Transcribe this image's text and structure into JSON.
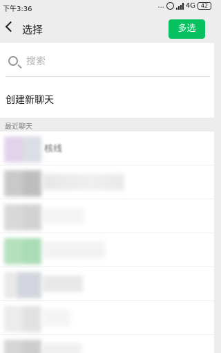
{
  "status_bar": {
    "time": "下午3:36",
    "dots": "...",
    "network": "4G",
    "battery": "42"
  },
  "header": {
    "title": "选择",
    "multi_select_label": "多选"
  },
  "search": {
    "placeholder": "搜索"
  },
  "new_chat_label": "创建新聊天",
  "recent_section_label": "最近聊天",
  "recent_chats": [
    {
      "name": "核线"
    }
  ],
  "colors": {
    "accent": "#07c160",
    "background": "#ededed"
  }
}
